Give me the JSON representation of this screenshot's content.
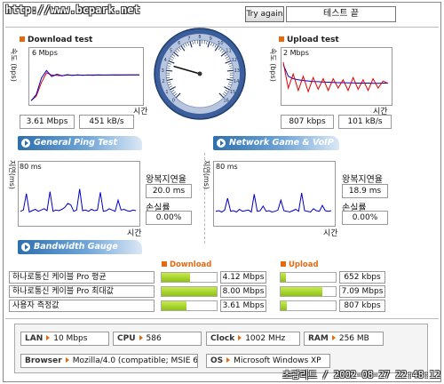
{
  "watermark": "http://www.bcpark.net",
  "header": {
    "try_again_label": "Try again",
    "status_text": "테스트 끝"
  },
  "download": {
    "title": "Download test",
    "axis_unit": "속도 (bps)",
    "max_label": "6 Mbps",
    "x_label": "시간",
    "mbps": "3.61 Mbps",
    "kbs": "451 kB/s",
    "chart_data": {
      "type": "line",
      "title": "Download test",
      "xlabel": "시간",
      "ylabel": "속도 (bps)",
      "ylim": [
        0,
        6
      ],
      "y_unit": "Mbps",
      "series": [
        {
          "values": [
            0.2,
            0.8,
            2.6,
            3.9,
            3.6,
            3.55,
            3.5,
            3.6,
            3.55,
            3.6,
            3.58,
            3.6,
            3.57,
            3.6,
            3.59,
            3.6,
            3.6,
            3.61,
            3.6,
            3.61,
            3.61,
            3.61
          ]
        },
        {
          "values": [
            0.2,
            1.0,
            3.2,
            4.2,
            3.4,
            3.7,
            3.5,
            3.65,
            3.55,
            3.62,
            3.58,
            3.6,
            3.6,
            3.62,
            3.6,
            3.6,
            3.61,
            3.6,
            3.61,
            3.61,
            3.61,
            3.61
          ]
        }
      ]
    }
  },
  "upload": {
    "title": "Upload test",
    "axis_unit": "속도 (bps)",
    "max_label": "2 Mbps",
    "x_label": "시간",
    "kbps": "807 kbps",
    "kbs": "101 kB/s",
    "chart_data": {
      "type": "line",
      "title": "Upload test",
      "xlabel": "시간",
      "ylabel": "속도 (bps)",
      "ylim": [
        0,
        2
      ],
      "y_unit": "Mbps",
      "series": [
        {
          "values": [
            1.6,
            1.1,
            1.0,
            0.95,
            0.92,
            0.9,
            0.88,
            0.87,
            0.86,
            0.85,
            0.84,
            0.83,
            0.83,
            0.82,
            0.82,
            0.81,
            0.81,
            0.81,
            0.8,
            0.8,
            0.81,
            0.81
          ]
        },
        {
          "values": [
            1.7,
            0.6,
            1.2,
            0.5,
            1.1,
            0.45,
            1.05,
            0.55,
            1.0,
            0.5,
            1.0,
            0.6,
            0.95,
            0.5,
            1.05,
            0.55,
            0.95,
            0.5,
            1.0,
            0.6,
            0.9,
            0.8
          ]
        }
      ]
    }
  },
  "gauge": {
    "ticks": [
      "0",
      "1",
      "2",
      "3",
      "4",
      "5",
      "6",
      "7",
      "8",
      "9",
      "10",
      "11",
      "12",
      "13",
      "14",
      "15",
      "16"
    ],
    "needle_value": 3.61
  },
  "ping": {
    "banner": "General Ping Test",
    "axis_unit": "지연(ms)",
    "max_label": "80 ms",
    "x_label": "시간",
    "rtt_label": "왕복지연율",
    "rtt_value": "20.0 ms",
    "loss_label": "손실률",
    "loss_value": "0.00%",
    "chart_data": {
      "type": "line",
      "xlabel": "시간",
      "ylabel": "지연(ms)",
      "ylim": [
        0,
        80
      ],
      "series": [
        {
          "values": [
            18,
            20,
            45,
            17,
            19,
            21,
            18,
            20,
            22,
            19,
            48,
            18,
            20,
            19,
            21,
            24,
            30,
            28,
            18,
            20,
            52,
            19,
            20,
            18,
            21,
            19,
            20,
            47,
            18,
            19,
            22,
            20,
            18,
            35,
            20,
            21,
            19,
            18,
            20,
            19
          ]
        }
      ]
    }
  },
  "game": {
    "banner": "Network Game & VoIP Test",
    "axis_unit": "지연(ms)",
    "max_label": "80 ms",
    "x_label": "시간",
    "rtt_label": "왕복지연율",
    "rtt_value": "18.9 ms",
    "loss_label": "손실률",
    "loss_value": "0.00%",
    "chart_data": {
      "type": "line",
      "xlabel": "시간",
      "ylabel": "지연(ms)",
      "ylim": [
        0,
        80
      ],
      "series": [
        {
          "values": [
            18,
            19,
            17,
            20,
            38,
            18,
            19,
            17,
            21,
            18,
            19,
            20,
            17,
            44,
            18,
            19,
            26,
            18,
            19,
            17,
            18,
            20,
            35,
            19,
            18,
            17,
            19,
            21,
            18,
            46,
            19,
            18,
            17,
            22,
            19,
            18,
            27,
            19,
            18,
            19
          ]
        }
      ]
    }
  },
  "bandwidth": {
    "banner": "Bandwidth Gauge",
    "download_header": "Download",
    "upload_header": "Upload",
    "rows": [
      {
        "label": "하나로통신 케이블 Pro 평균",
        "down_value": "4.12 Mbps",
        "down_fraction": 0.51,
        "up_value": "652 kbps",
        "up_fraction": 0.09
      },
      {
        "label": "하나로통신 케이블 Pro 최대값",
        "down_value": "8.00 Mbps",
        "down_fraction": 1.0,
        "up_value": "7.09 Mbps",
        "up_fraction": 0.75
      },
      {
        "label": "사용자 측정값",
        "down_value": "3.61 Mbps",
        "down_fraction": 0.45,
        "up_value": "807 kbps",
        "up_fraction": 0.11
      }
    ]
  },
  "system": {
    "lan_label": "LAN",
    "lan_value": "10 Mbps",
    "cpu_label": "CPU",
    "cpu_value": "586",
    "clock_label": "Clock",
    "clock_value": "1002 MHz",
    "ram_label": "RAM",
    "ram_value": "256 MB",
    "browser_label": "Browser",
    "browser_value": "Mozilla/4.0 (compatible; MSIE 6.0",
    "os_label": "OS",
    "os_value": "Microsoft Windows XP"
  },
  "footer": "초광리트 / 2002-08-27 22:48:12",
  "colors": {
    "accent": "#e46a12",
    "banner": "#2e6fae",
    "bar": "#9bcb1c",
    "line_red": "#e00000",
    "line_blue": "#0000c8"
  }
}
